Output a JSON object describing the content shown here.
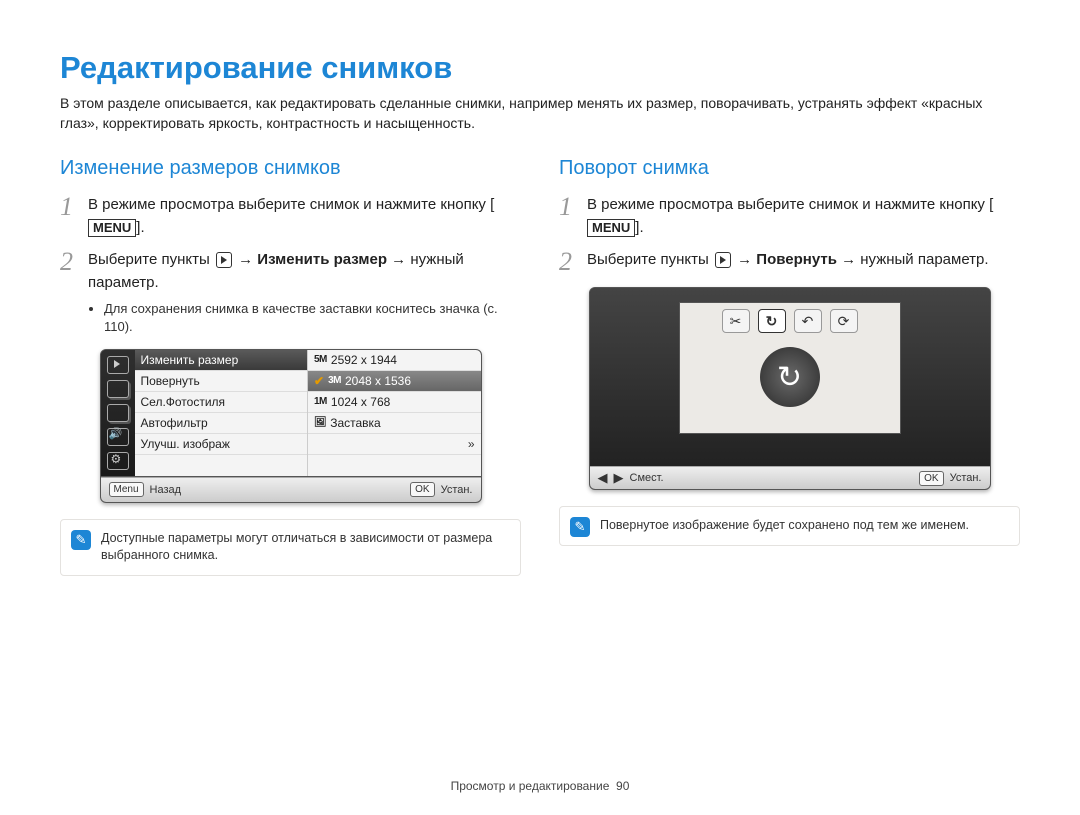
{
  "page": {
    "title": "Редактирование снимков",
    "intro": "В этом разделе описывается, как редактировать сделанные снимки, например менять их размер, поворачивать, устранять эффект «красных глаз», корректировать яркость, контрастность и насыщенность.",
    "footer_section": "Просмотр и редактирование",
    "footer_page": "90"
  },
  "left": {
    "heading": "Изменение размеров снимков",
    "step1_a": "В режиме просмотра выберите снимок и нажмите кнопку [",
    "step1_key": "MENU",
    "step1_b": "].",
    "step2_a": "Выберите пункты ",
    "step2_bold": "Изменить размер",
    "step2_b": " → нужный параметр.",
    "sub_text": "Для сохранения снимка в качестве заставки коснитесь значка (с. 110).",
    "note": "Доступные параметры могут отличаться в зависимости от размера выбранного снимка."
  },
  "right": {
    "heading": "Поворот снимка",
    "step1_a": "В режиме просмотра выберите снимок и нажмите кнопку [",
    "step1_key": "MENU",
    "step1_b": "].",
    "step2_a": "Выберите пункты ",
    "step2_bold": "Повернуть",
    "step2_b": " → нужный параметр.",
    "note": "Повернутое изображение будет сохранено под тем же именем."
  },
  "cam_left": {
    "menu": [
      "Изменить размер",
      "Повернуть",
      "Сел.Фотостиля",
      "Автофильтр",
      "Улучш. изображ"
    ],
    "opts": [
      {
        "mp": "5M",
        "res": "2592 x 1944",
        "sel": false,
        "chk": false
      },
      {
        "mp": "3M",
        "res": "2048 x 1536",
        "sel": true,
        "chk": true
      },
      {
        "mp": "1M",
        "res": "1024 x 768",
        "sel": false,
        "chk": false
      },
      {
        "mp": "",
        "res": "Заставка",
        "sel": false,
        "chk": false
      }
    ],
    "more": "»",
    "foot_menu_key": "Menu",
    "foot_menu_label": "Назад",
    "foot_ok_key": "OK",
    "foot_ok_label": "Устан."
  },
  "cam_right": {
    "foot_nav_label": "Смест.",
    "foot_ok_key": "OK",
    "foot_ok_label": "Устан."
  }
}
